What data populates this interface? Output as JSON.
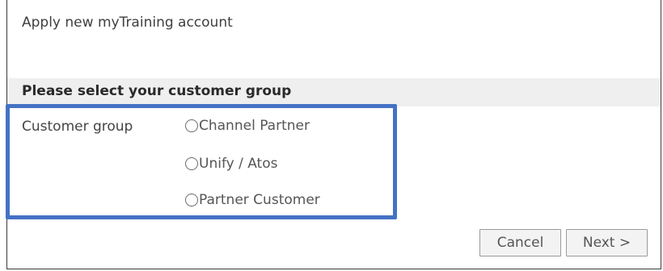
{
  "header": {
    "title": "Apply new myTraining account"
  },
  "section": {
    "title": "Please select your customer group"
  },
  "customer_group": {
    "label": "Customer group",
    "options": [
      {
        "label": "Channel Partner",
        "selected": false
      },
      {
        "label": "Unify / Atos",
        "selected": false
      },
      {
        "label": "Partner Customer",
        "selected": false
      }
    ]
  },
  "buttons": {
    "cancel_label": "Cancel",
    "next_label": "Next >"
  },
  "colors": {
    "highlight_border": "#4472c4",
    "section_background": "#efefef"
  }
}
